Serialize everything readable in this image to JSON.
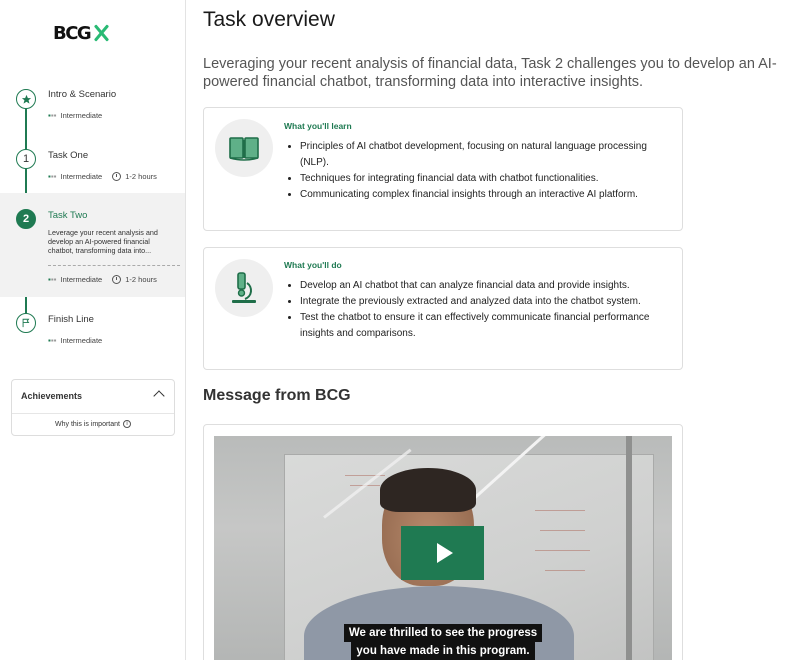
{
  "sidebar": {
    "logo_text": "BCG",
    "steps": [
      {
        "title": "Intro & Scenario",
        "level": "Intermediate",
        "duration": ""
      },
      {
        "title": "Task One",
        "level": "Intermediate",
        "duration": "1-2 hours",
        "number": "1"
      },
      {
        "title": "Task Two",
        "level": "Intermediate",
        "duration": "1-2 hours",
        "number": "2",
        "description": "Leverage your recent analysis and develop an AI-powered financial chatbot, transforming data into..."
      },
      {
        "title": "Finish Line",
        "level": "Intermediate",
        "duration": ""
      }
    ],
    "achievements": {
      "title": "Achievements",
      "why": "Why this is important"
    }
  },
  "main": {
    "title": "Task overview",
    "intro": "Leveraging your recent analysis of financial data, Task 2 challenges you to develop an AI-powered financial chatbot, transforming data into interactive insights.",
    "learn": {
      "heading": "What you'll learn",
      "items": [
        "Principles of AI chatbot development, focusing on natural language processing (NLP).",
        "Techniques for integrating financial data with chatbot functionalities.",
        "Communicating complex financial insights through an interactive AI platform."
      ]
    },
    "do": {
      "heading": "What you'll do",
      "items": [
        "Develop an AI chatbot that can analyze financial data and provide insights.",
        "Integrate the previously extracted and analyzed data into the chatbot system.",
        "Test the chatbot to ensure it can effectively communicate financial performance insights and comparisons."
      ]
    },
    "message_title": "Message from BCG",
    "video": {
      "caption_line1": "We are thrilled to see the progress",
      "caption_line2": "you have made in this program."
    }
  },
  "colors": {
    "accent": "#1f7a52",
    "logo_x": "#29ba74"
  }
}
